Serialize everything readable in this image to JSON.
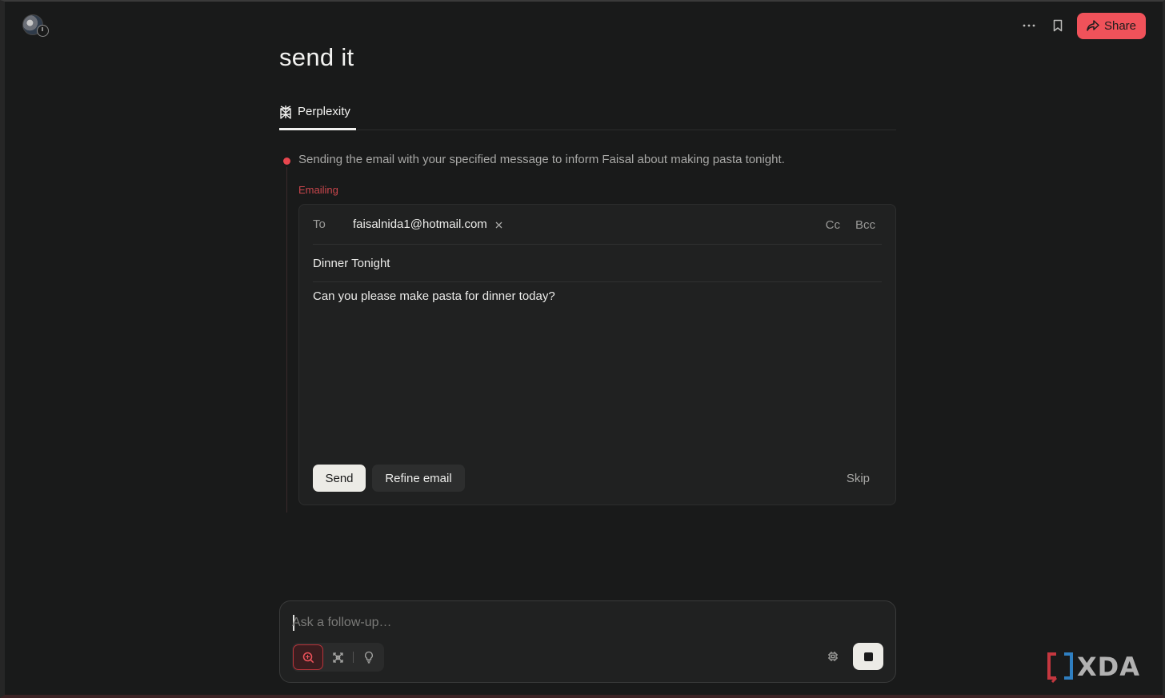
{
  "header": {
    "more_icon": "ellipsis-icon",
    "bookmark_icon": "bookmark-icon",
    "share_label": "Share"
  },
  "thread": {
    "title": "send it",
    "tabs": [
      {
        "label": "Perplexity",
        "icon": "perplexity-logo-icon",
        "active": true
      }
    ]
  },
  "step": {
    "text": "Sending the email with your specified message to inform Faisal about making pasta tonight.",
    "status": "Emailing"
  },
  "email": {
    "to_label": "To",
    "recipient": "faisalnida1@hotmail.com",
    "cc_label": "Cc",
    "bcc_label": "Bcc",
    "subject": "Dinner Tonight",
    "body": "Can you please make pasta for dinner today?",
    "send_label": "Send",
    "refine_label": "Refine email",
    "skip_label": "Skip"
  },
  "followup": {
    "placeholder": "Ask a follow-up…",
    "modes": [
      "search-icon",
      "reasoning-icon",
      "lightbulb-icon"
    ],
    "active_mode": "search-icon"
  },
  "watermark": {
    "text": "XDA"
  },
  "colors": {
    "accent": "#f0525a",
    "background": "#191a1a",
    "card": "#202121"
  }
}
